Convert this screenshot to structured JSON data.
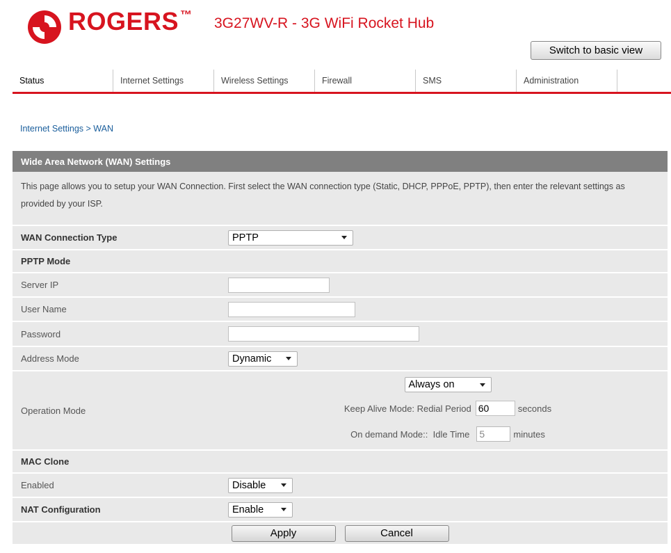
{
  "header": {
    "brand": "ROGERS",
    "trademark": "™",
    "product": "3G27WV-R - 3G WiFi Rocket Hub",
    "switch_label": "Switch to basic view",
    "logo_icon": "rogers-logo-icon",
    "brand_color": "#d7141f"
  },
  "tabs": [
    {
      "label": "Status"
    },
    {
      "label": "Internet Settings"
    },
    {
      "label": "Wireless Settings"
    },
    {
      "label": "Firewall"
    },
    {
      "label": "SMS"
    },
    {
      "label": "Administration"
    }
  ],
  "breadcrumb": "Internet Settings > WAN",
  "panel": {
    "title": "Wide Area Network (WAN) Settings",
    "intro": "This page allows you to setup your WAN Connection. First select the WAN connection type (Static, DHCP, PPPoE, PPTP), then enter the relevant settings as provided by your ISP."
  },
  "form": {
    "wan_type_label": "WAN Connection Type",
    "wan_type_value": "PPTP",
    "pptp_mode_label": "PPTP Mode",
    "server_ip_label": "Server IP",
    "server_ip_value": "",
    "user_name_label": "User Name",
    "user_name_value": "",
    "password_label": "Password",
    "password_value": "",
    "address_mode_label": "Address Mode",
    "address_mode_value": "Dynamic",
    "operation_mode_label": "Operation Mode",
    "operation_mode_value": "Always on",
    "keep_alive_label": "Keep Alive Mode: Redial Period",
    "keep_alive_value": "60",
    "keep_alive_unit": "seconds",
    "on_demand_label": "On demand Mode::  Idle Time",
    "on_demand_value": "5",
    "on_demand_unit": "minutes",
    "mac_clone_label": "MAC Clone",
    "enabled_label": "Enabled",
    "enabled_value": "Disable",
    "nat_label": "NAT Configuration",
    "nat_value": "Enable"
  },
  "buttons": {
    "apply": "Apply",
    "cancel": "Cancel"
  }
}
